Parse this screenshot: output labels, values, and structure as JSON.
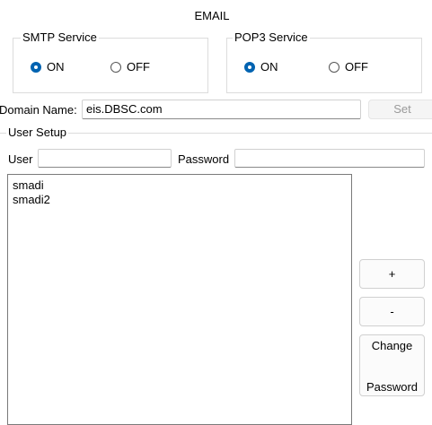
{
  "title": "EMAIL",
  "smtp": {
    "label": "SMTP Service",
    "on_label": "ON",
    "off_label": "OFF",
    "selected": "ON"
  },
  "pop3": {
    "label": "POP3 Service",
    "on_label": "ON",
    "off_label": "OFF",
    "selected": "ON"
  },
  "domain": {
    "label": "Domain Name:",
    "value": "eis.DBSC.com",
    "set_label": "Set"
  },
  "user_setup": {
    "label": "User Setup",
    "user_label": "User",
    "user_value": "",
    "password_label": "Password",
    "password_value": "",
    "users": [
      "smadi",
      "smadi2"
    ],
    "add_label": "+",
    "remove_label": "-",
    "change_password_line1": "Change",
    "change_password_line2": "Password"
  },
  "colors": {
    "accent": "#0063b1"
  }
}
